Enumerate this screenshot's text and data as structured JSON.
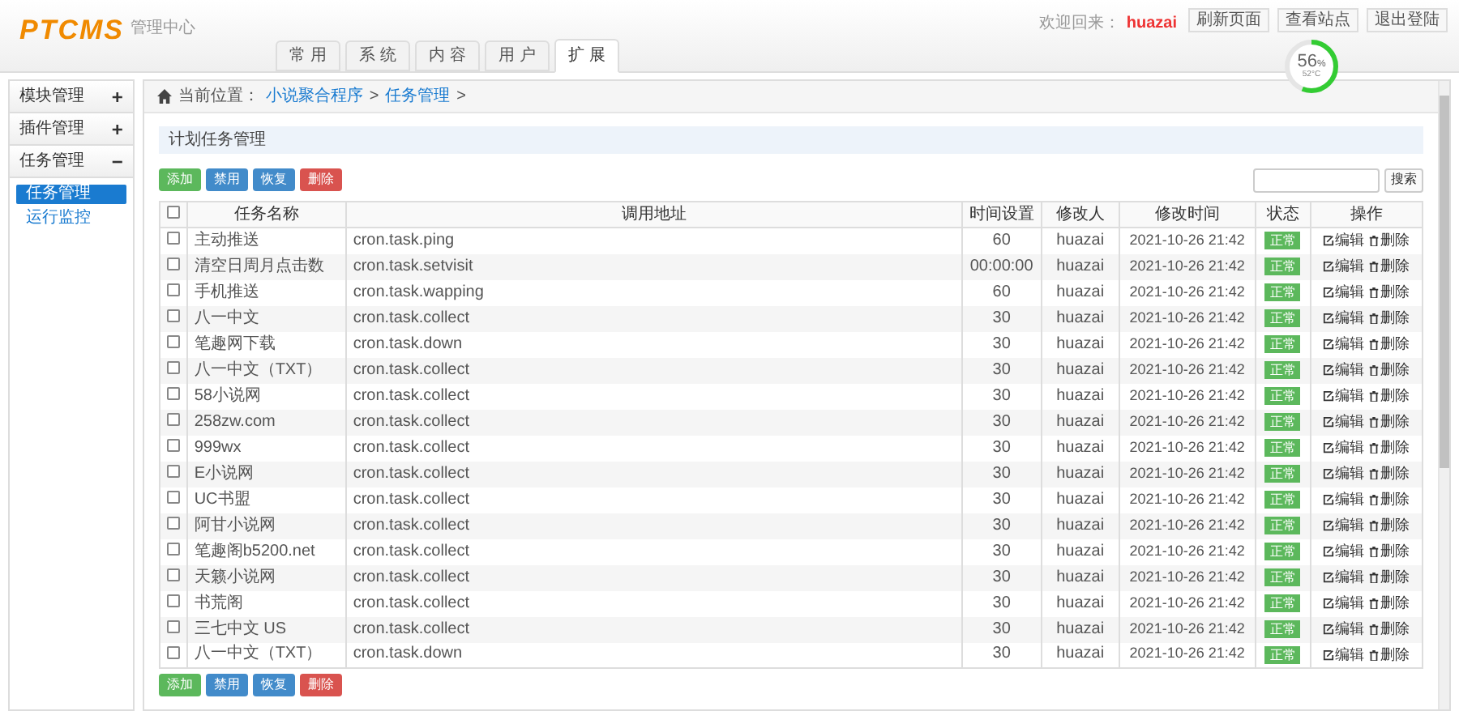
{
  "header": {
    "logo": "PTCMS",
    "subtitle": "管理中心",
    "welcome": "欢迎回来：",
    "user": "huazai",
    "links": [
      "刷新页面",
      "查看站点",
      "退出登陆"
    ],
    "gauge": {
      "value": "56",
      "unit": "%",
      "temp": "52°C",
      "level": 0.56
    }
  },
  "tabs": [
    {
      "label": "常 用",
      "selected": false
    },
    {
      "label": "系 统",
      "selected": false
    },
    {
      "label": "内 容",
      "selected": false
    },
    {
      "label": "用 户",
      "selected": false
    },
    {
      "label": "扩 展",
      "selected": true
    }
  ],
  "sidebar": [
    {
      "label": "模块管理",
      "toggle": "+"
    },
    {
      "label": "插件管理",
      "toggle": "+"
    },
    {
      "label": "任务管理",
      "toggle": "−",
      "children": [
        {
          "label": "任务管理",
          "selected": true
        },
        {
          "label": "运行监控",
          "selected": false
        }
      ]
    }
  ],
  "breadcrumb": {
    "label": "当前位置：",
    "items": [
      "小说聚合程序",
      "任务管理"
    ],
    "separator": ">"
  },
  "panel_title": "计划任务管理",
  "toolbar": [
    {
      "label": "添加",
      "kind": "success"
    },
    {
      "label": "禁用",
      "kind": "primary"
    },
    {
      "label": "恢复",
      "kind": "primary"
    },
    {
      "label": "删除",
      "kind": "danger"
    }
  ],
  "search_button": "搜索",
  "table": {
    "select_all_checked": false,
    "columns": [
      "任务名称",
      "调用地址",
      "时间设置",
      "修改人",
      "修改时间",
      "状态",
      "操作"
    ],
    "rows": [
      {
        "checked": false,
        "name": "主动推送",
        "url": "cron.task.ping",
        "time": "60",
        "user": "huazai",
        "modified": "2021-10-26 21:42",
        "status": "正常",
        "actions": [
          "编辑",
          "删除"
        ]
      },
      {
        "checked": false,
        "name": "清空日周月点击数",
        "url": "cron.task.setvisit",
        "time": "00:00:00",
        "user": "huazai",
        "modified": "2021-10-26 21:42",
        "status": "正常",
        "actions": [
          "编辑",
          "删除"
        ]
      },
      {
        "checked": false,
        "name": "手机推送",
        "url": "cron.task.wapping",
        "time": "60",
        "user": "huazai",
        "modified": "2021-10-26 21:42",
        "status": "正常",
        "actions": [
          "编辑",
          "删除"
        ]
      },
      {
        "checked": false,
        "name": "八一中文",
        "url": "cron.task.collect",
        "time": "30",
        "user": "huazai",
        "modified": "2021-10-26 21:42",
        "status": "正常",
        "actions": [
          "编辑",
          "删除"
        ]
      },
      {
        "checked": false,
        "name": "笔趣网下载",
        "url": "cron.task.down",
        "time": "30",
        "user": "huazai",
        "modified": "2021-10-26 21:42",
        "status": "正常",
        "actions": [
          "编辑",
          "删除"
        ]
      },
      {
        "checked": false,
        "name": "八一中文（TXT）",
        "url": "cron.task.collect",
        "time": "30",
        "user": "huazai",
        "modified": "2021-10-26 21:42",
        "status": "正常",
        "actions": [
          "编辑",
          "删除"
        ]
      },
      {
        "checked": false,
        "name": "58小说网",
        "url": "cron.task.collect",
        "time": "30",
        "user": "huazai",
        "modified": "2021-10-26 21:42",
        "status": "正常",
        "actions": [
          "编辑",
          "删除"
        ]
      },
      {
        "checked": false,
        "name": "258zw.com",
        "url": "cron.task.collect",
        "time": "30",
        "user": "huazai",
        "modified": "2021-10-26 21:42",
        "status": "正常",
        "actions": [
          "编辑",
          "删除"
        ]
      },
      {
        "checked": false,
        "name": "999wx",
        "url": "cron.task.collect",
        "time": "30",
        "user": "huazai",
        "modified": "2021-10-26 21:42",
        "status": "正常",
        "actions": [
          "编辑",
          "删除"
        ]
      },
      {
        "checked": false,
        "name": "E小说网",
        "url": "cron.task.collect",
        "time": "30",
        "user": "huazai",
        "modified": "2021-10-26 21:42",
        "status": "正常",
        "actions": [
          "编辑",
          "删除"
        ]
      },
      {
        "checked": false,
        "name": "UC书盟",
        "url": "cron.task.collect",
        "time": "30",
        "user": "huazai",
        "modified": "2021-10-26 21:42",
        "status": "正常",
        "actions": [
          "编辑",
          "删除"
        ]
      },
      {
        "checked": false,
        "name": "阿甘小说网",
        "url": "cron.task.collect",
        "time": "30",
        "user": "huazai",
        "modified": "2021-10-26 21:42",
        "status": "正常",
        "actions": [
          "编辑",
          "删除"
        ]
      },
      {
        "checked": false,
        "name": "笔趣阁b5200.net",
        "url": "cron.task.collect",
        "time": "30",
        "user": "huazai",
        "modified": "2021-10-26 21:42",
        "status": "正常",
        "actions": [
          "编辑",
          "删除"
        ]
      },
      {
        "checked": false,
        "name": "天籁小说网",
        "url": "cron.task.collect",
        "time": "30",
        "user": "huazai",
        "modified": "2021-10-26 21:42",
        "status": "正常",
        "actions": [
          "编辑",
          "删除"
        ]
      },
      {
        "checked": false,
        "name": "书荒阁",
        "url": "cron.task.collect",
        "time": "30",
        "user": "huazai",
        "modified": "2021-10-26 21:42",
        "status": "正常",
        "actions": [
          "编辑",
          "删除"
        ]
      },
      {
        "checked": false,
        "name": "三七中文 US",
        "url": "cron.task.collect",
        "time": "30",
        "user": "huazai",
        "modified": "2021-10-26 21:42",
        "status": "正常",
        "actions": [
          "编辑",
          "删除"
        ]
      },
      {
        "checked": false,
        "name": "八一中文（TXT）",
        "url": "cron.task.down",
        "time": "30",
        "user": "huazai",
        "modified": "2021-10-26 21:42",
        "status": "正常",
        "actions": [
          "编辑",
          "删除"
        ]
      }
    ]
  },
  "bottom_toolbar": [
    {
      "label": "添加",
      "kind": "success"
    },
    {
      "label": "禁用",
      "kind": "primary"
    },
    {
      "label": "恢复",
      "kind": "primary"
    },
    {
      "label": "删除",
      "kind": "danger"
    }
  ]
}
